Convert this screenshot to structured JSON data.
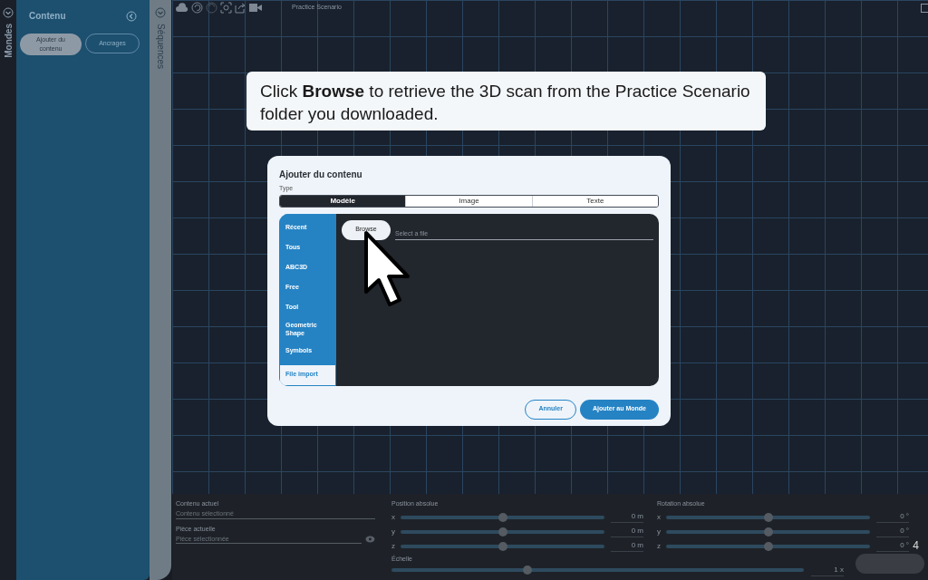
{
  "left_rail": {
    "label": "Mondes"
  },
  "sidebar": {
    "title": "Contenu",
    "buttons": [
      {
        "label": "Ajouter du contenu",
        "selected": true
      },
      {
        "label": "Ancrages",
        "selected": false
      }
    ]
  },
  "sequences_rail": {
    "label": "Séquences"
  },
  "toolbar": {
    "project_title": "Practice Scenario"
  },
  "tutorial_callout": {
    "text": "Click **Browse** to retrieve the 3D scan from the Practice Scenario folder you downloaded."
  },
  "dialog": {
    "title": "Ajouter du contenu",
    "type_label": "Type",
    "tabs": [
      {
        "label": "Modèle",
        "selected": true
      },
      {
        "label": "Image",
        "selected": false
      },
      {
        "label": "Texte",
        "selected": false
      }
    ],
    "categories": [
      {
        "label": "Récent",
        "selected": false
      },
      {
        "label": "Tous",
        "selected": false
      },
      {
        "label": "ABC3D",
        "selected": false
      },
      {
        "label": "Free",
        "selected": false
      },
      {
        "label": "Tool",
        "selected": false
      },
      {
        "label": "Geometric Shape",
        "selected": false
      },
      {
        "label": "Symbols",
        "selected": false
      },
      {
        "label": "File import",
        "selected": true
      }
    ],
    "browse_button": "Browse",
    "file_field": {
      "placeholder": "Select a file"
    },
    "buttons": [
      {
        "label": "Annuler",
        "kind": "secondary"
      },
      {
        "label": "Ajouter au Monde",
        "kind": "primary"
      }
    ]
  },
  "properties": {
    "current_content": {
      "label": "Contenu actuel",
      "placeholder": "Contenu sélectionné"
    },
    "current_part": {
      "label": "Pièce actuelle",
      "placeholder": "Pièce sélectionnée"
    },
    "position": {
      "title": "Position absolue",
      "axes": [
        {
          "axis": "x",
          "level": 0.5,
          "value": "0",
          "unit": "m"
        },
        {
          "axis": "y",
          "level": 0.5,
          "value": "0",
          "unit": "m"
        },
        {
          "axis": "z",
          "level": 0.5,
          "value": "0",
          "unit": "m"
        }
      ]
    },
    "rotation": {
      "title": "Rotation absolue",
      "axes": [
        {
          "axis": "x",
          "level": 0.5,
          "value": "0",
          "unit": "°"
        },
        {
          "axis": "y",
          "level": 0.5,
          "value": "0",
          "unit": "°"
        },
        {
          "axis": "z",
          "level": 0.5,
          "value": "0",
          "unit": "°"
        }
      ]
    },
    "scale": {
      "title": "Échelle",
      "level": 0.33,
      "value": "1",
      "unit": "x"
    }
  },
  "page_number": "4"
}
